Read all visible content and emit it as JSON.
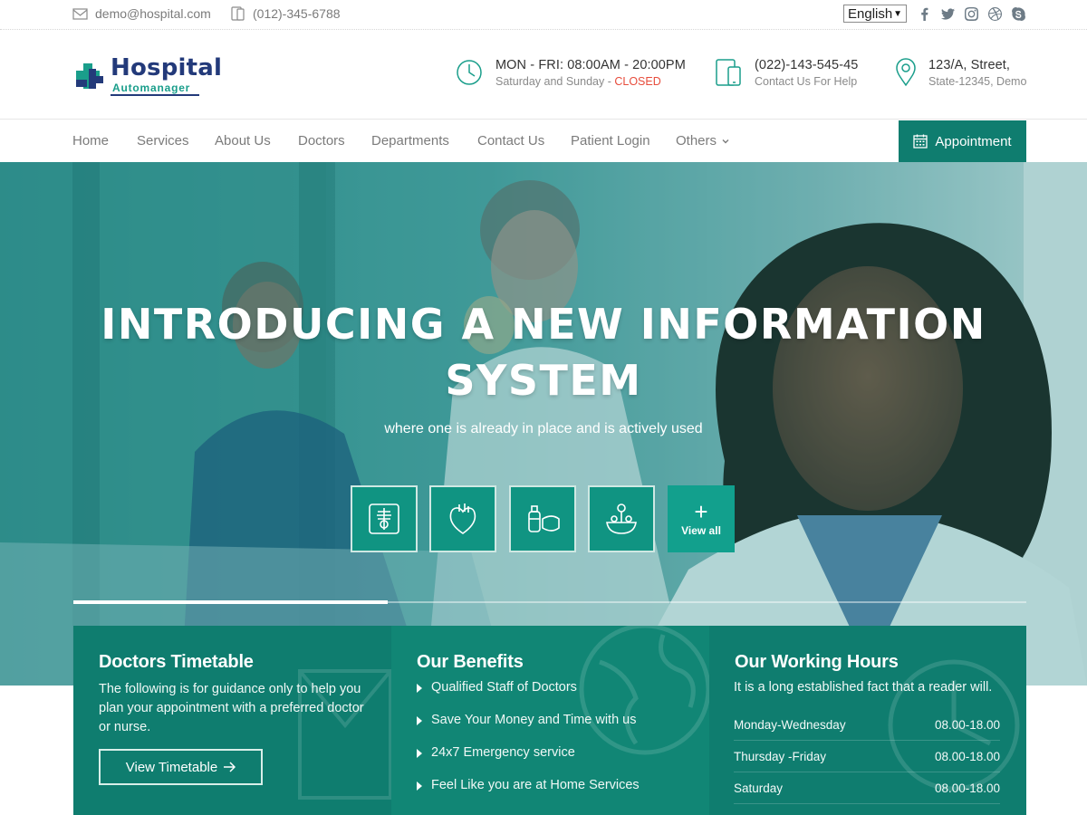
{
  "topbar": {
    "email": "demo@hospital.com",
    "phone": "(012)-345-6788",
    "language": "English",
    "social_icons": [
      "facebook-icon",
      "twitter-icon",
      "instagram-icon",
      "dribbble-icon",
      "skype-icon"
    ]
  },
  "header": {
    "logo": {
      "word1": "Hospital",
      "word2": "Automanager"
    },
    "hours": {
      "line1": "MON - FRI: 08:00AM - 20:00PM",
      "line2_prefix": "Saturday and Sunday - ",
      "line2_status": "CLOSED"
    },
    "contact": {
      "line1": "(022)-143-545-45",
      "line2": "Contact Us For Help"
    },
    "address": {
      "line1": "123/A, Street,",
      "line2": "State-12345, Demo"
    }
  },
  "nav": {
    "items": [
      "Home",
      "Services",
      "About Us",
      "Doctors",
      "Departments",
      "Contact Us",
      "Patient Login",
      "Others"
    ],
    "appointment": "Appointment"
  },
  "hero": {
    "title_line1": "INTRODUCING A NEW INFORMATION",
    "title_line2": "SYSTEM",
    "subtitle": "where one is already in place and is actively used",
    "services": [
      "x-ray-icon",
      "heart-icon",
      "baby-care-icon",
      "pharmacy-icon"
    ],
    "view_all": "View all",
    "slider_progress": 0.33
  },
  "panels": {
    "timetable": {
      "title": "Doctors Timetable",
      "description": "The following is for guidance only to help you plan your appointment with a preferred doctor or nurse.",
      "button": "View Timetable"
    },
    "benefits": {
      "title": "Our Benefits",
      "items": [
        "Qualified Staff of Doctors",
        "Save Your Money and Time with us",
        "24x7 Emergency service",
        "Feel Like you are at Home Services"
      ]
    },
    "working_hours": {
      "title": "Our Working Hours",
      "description": "It is a long established fact that a reader will.",
      "rows": [
        {
          "day": "Monday-Wednesday",
          "time": "08.00-18.00"
        },
        {
          "day": "Thursday -Friday",
          "time": "08.00-18.00"
        },
        {
          "day": "Saturday",
          "time": "08.00-18.00"
        }
      ]
    }
  },
  "colors": {
    "primary": "#0f7d6f",
    "accent": "#12a08d",
    "closed": "#e74c3c",
    "logo_navy": "#233a7a"
  }
}
